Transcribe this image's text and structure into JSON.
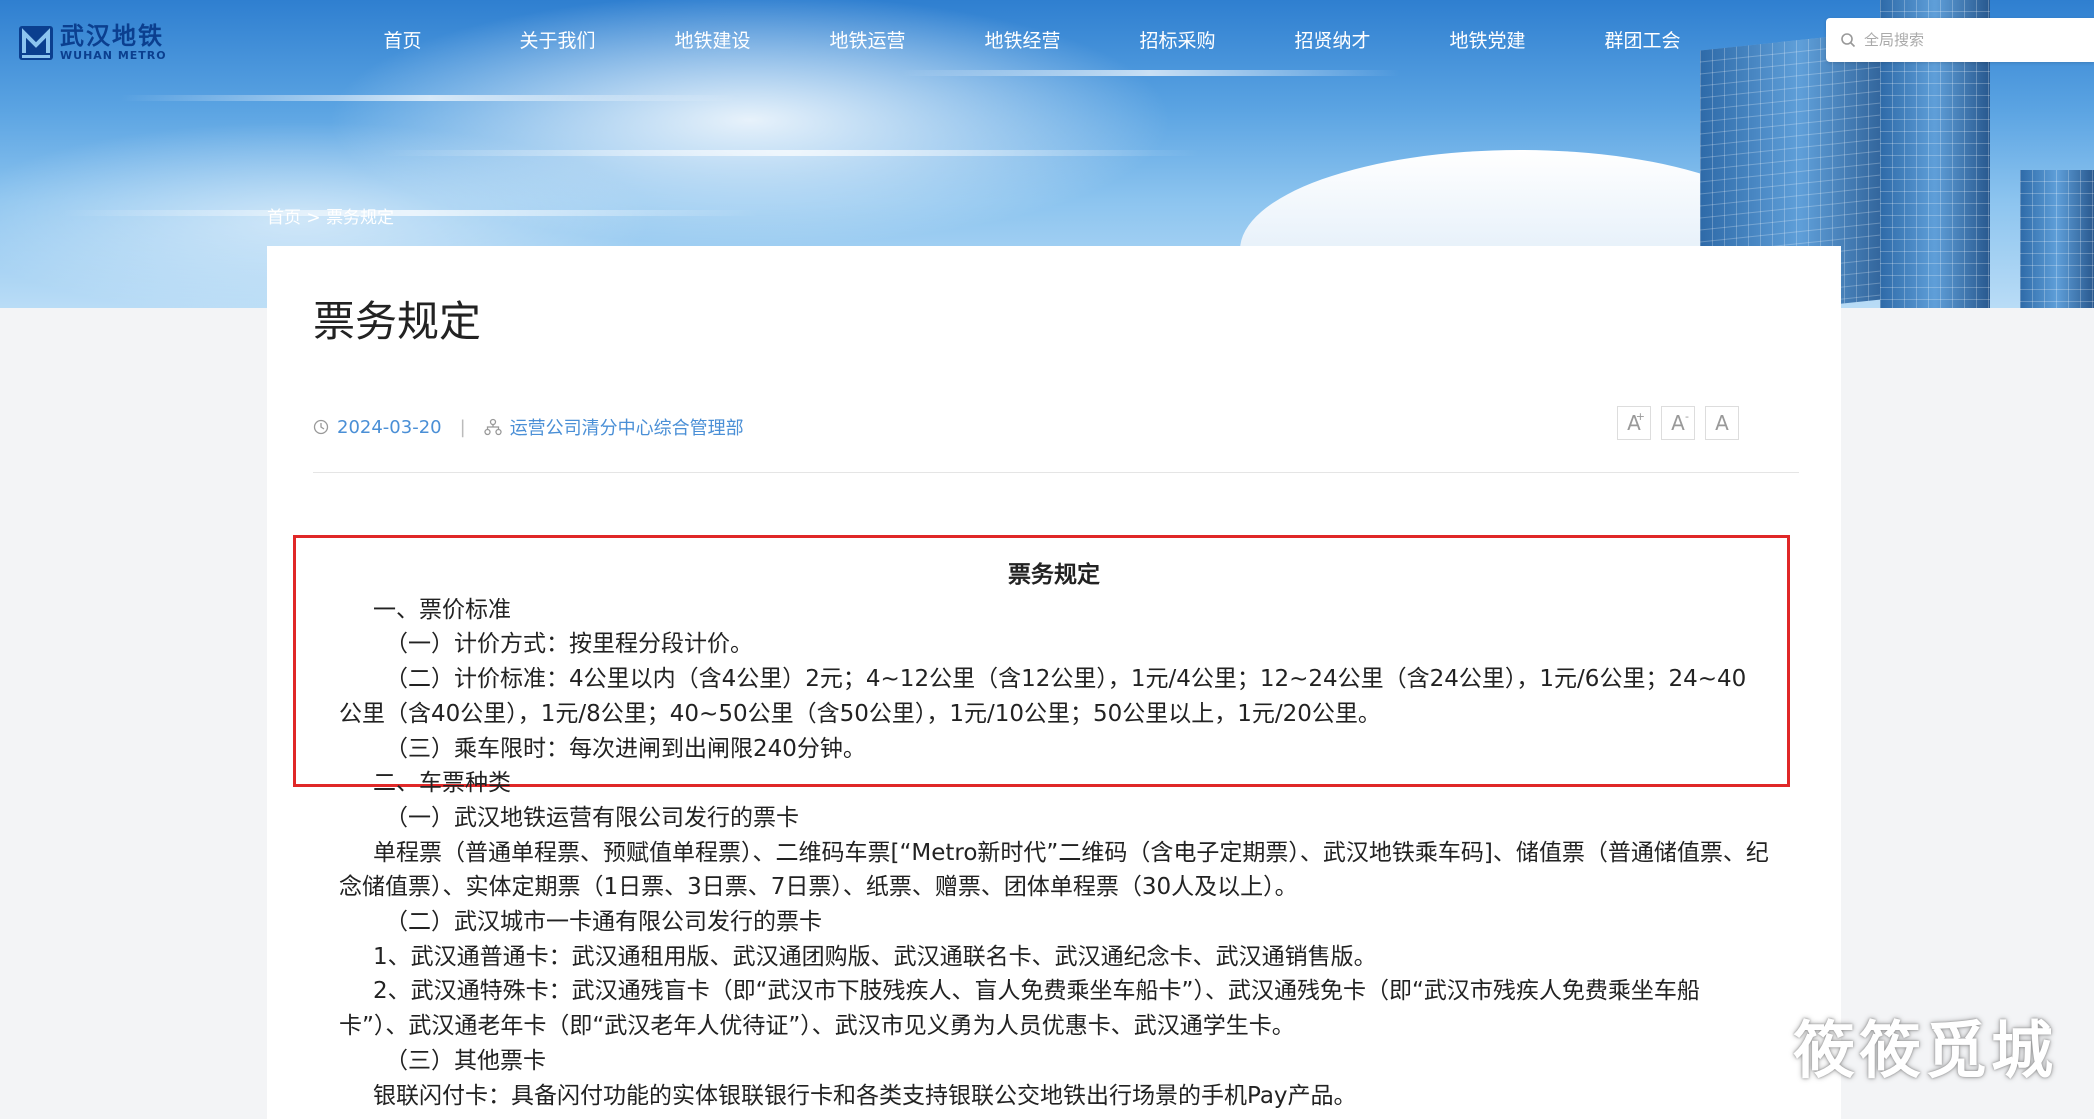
{
  "brand": {
    "logo_cn": "武汉地铁",
    "logo_en": "WUHAN METRO",
    "color": "#0b3f8f"
  },
  "nav": {
    "items": [
      "首页",
      "关于我们",
      "地铁建设",
      "地铁运营",
      "地铁经营",
      "招标采购",
      "招贤纳才",
      "地铁党建",
      "群团工会"
    ]
  },
  "search": {
    "placeholder": "全局搜索",
    "icon": "search-icon"
  },
  "breadcrumb": {
    "home": "首页",
    "separator": ">",
    "current": "票务规定"
  },
  "article": {
    "title": "票务规定",
    "date": "2024-03-20",
    "meta_separator": "|",
    "department": "运营公司清分中心综合管理部",
    "font_tools": {
      "larger": "A",
      "larger_sup": "+",
      "smaller": "A",
      "smaller_sup": "-",
      "reset": "A"
    },
    "body": {
      "heading": "票务规定",
      "p1": "一、票价标准",
      "p2": "（一）计价方式：按里程分段计价。",
      "p3": "（二）计价标准：4公里以内（含4公里）2元；4~12公里（含12公里），1元/4公里；12~24公里（含24公里），1元/6公里；24~40公里（含40公里），1元/8公里；40~50公里（含50公里），1元/10公里；50公里以上，1元/20公里。",
      "p4": "（三）乘车限时：每次进闸到出闸限240分钟。",
      "p5": "二、车票种类",
      "p6": "（一）武汉地铁运营有限公司发行的票卡",
      "p7": "单程票（普通单程票、预赋值单程票）、二维码车票[“Metro新时代”二维码（含电子定期票）、武汉地铁乘车码]、储值票（普通储值票、纪念储值票）、实体定期票（1日票、3日票、7日票）、纸票、赠票、团体单程票（30人及以上）。",
      "p8": "（二）武汉城市一卡通有限公司发行的票卡",
      "p9": "1、武汉通普通卡：武汉通租用版、武汉通团购版、武汉通联名卡、武汉通纪念卡、武汉通销售版。",
      "p10": "2、武汉通特殊卡：武汉通残盲卡（即“武汉市下肢残疾人、盲人免费乘坐车船卡”）、武汉通残免卡（即“武汉市残疾人免费乘坐车船卡”）、武汉通老年卡（即“武汉老年人优待证”）、武汉市见义勇为人员优惠卡、武汉通学生卡。",
      "p11": "（三）其他票卡",
      "p12": "银联闪付卡：具备闪付功能的实体银联银行卡和各类支持银联公交地铁出行场景的手机Pay产品。"
    }
  },
  "watermark": "筱筱觅城",
  "colors": {
    "accent": "#4a8fd6",
    "highlight_border": "#e02828",
    "hero": "#5aa3e2"
  }
}
